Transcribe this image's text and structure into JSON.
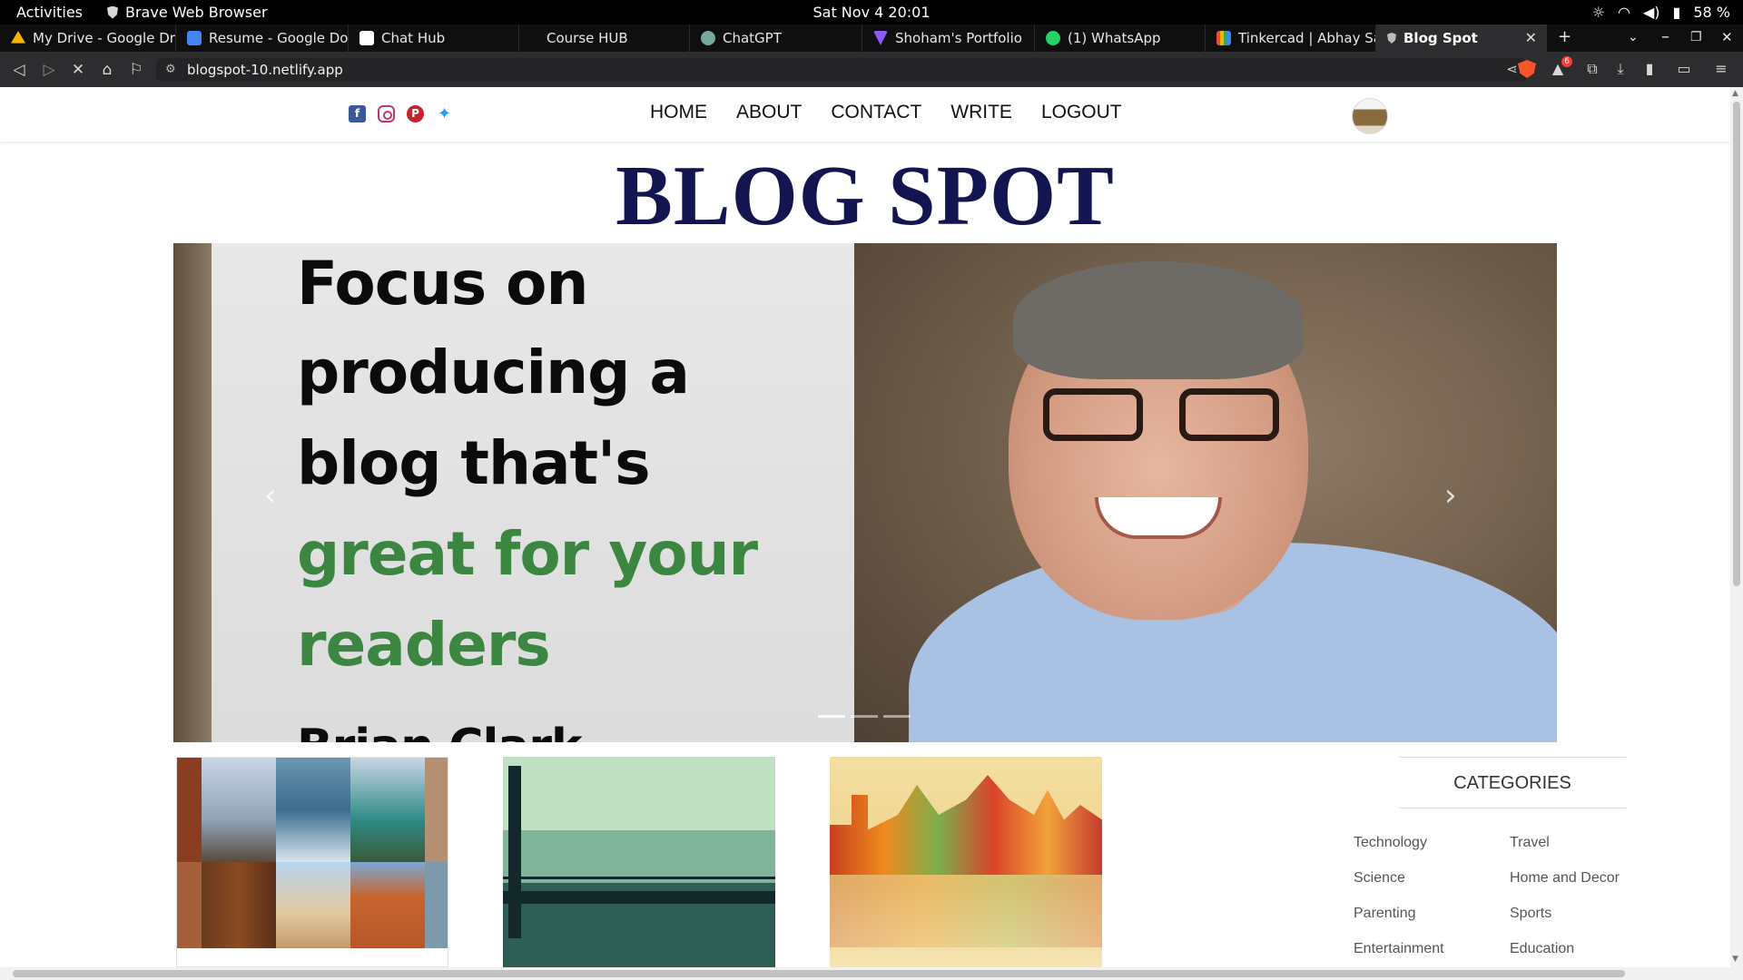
{
  "system": {
    "activities": "Activities",
    "app_name": "Brave Web Browser",
    "clock": "Sat Nov 4  20:01",
    "battery": "58 %"
  },
  "tabs": [
    {
      "label": "My Drive - Google Drive",
      "favicon_color": "#f4b400"
    },
    {
      "label": "Resume - Google Docs",
      "favicon_color": "#4285f4"
    },
    {
      "label": "Chat Hub",
      "favicon_color": "#ffffff"
    },
    {
      "label": "Course HUB",
      "favicon_color": ""
    },
    {
      "label": "ChatGPT",
      "favicon_color": "#74aa9c"
    },
    {
      "label": "Shoham's Portfolio",
      "favicon_color": "#8b5cf6"
    },
    {
      "label": "(1) WhatsApp",
      "favicon_color": "#25d366"
    },
    {
      "label": "Tinkercad | Abhay Sahu",
      "favicon_color": "#e84c3d"
    },
    {
      "label": "Blog Spot",
      "favicon_color": "#bbbbbb"
    }
  ],
  "address": {
    "url": "blogspot-10.netlify.app"
  },
  "extensions": {
    "brave_badge": "6"
  },
  "site": {
    "nav": [
      "HOME",
      "ABOUT",
      "CONTACT",
      "WRITE",
      "LOGOUT"
    ],
    "title": "BLOG SPOT",
    "socials": [
      "facebook-icon",
      "instagram-icon",
      "pinterest-icon",
      "twitter-icon"
    ]
  },
  "carousel": {
    "quote_lines": [
      "Focus on",
      "producing a",
      "blog that's",
      "great for your",
      "readers"
    ],
    "author": "Brian Clark",
    "prev_arrow": "‹",
    "next_arrow": "›",
    "slide_count": 3,
    "active_slide": 1
  },
  "categories": {
    "title": "CATEGORIES",
    "items": [
      "Technology",
      "Travel",
      "Science",
      "Home and Decor",
      "Parenting",
      "Sports",
      "Entertainment",
      "Education"
    ]
  },
  "colors": {
    "title": "#131550",
    "quote_green": "#3b8640",
    "active_tab": "#2d2d30"
  }
}
